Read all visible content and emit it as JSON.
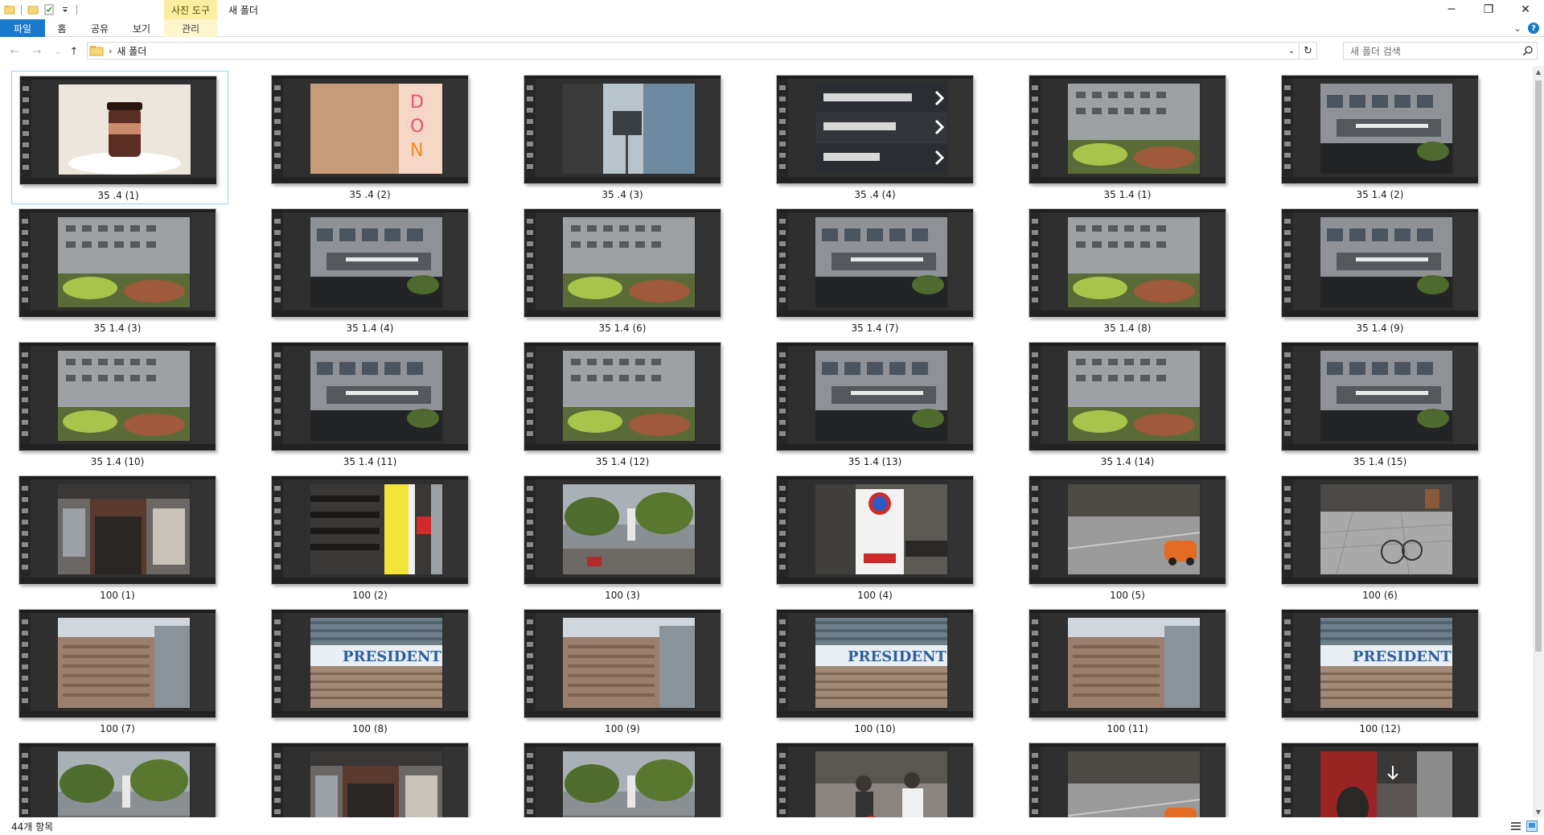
{
  "titlebar": {
    "context_tab_label": "사진 도구",
    "window_title": "새 폴더",
    "minimize": "─",
    "maximize": "❐",
    "close": "✕"
  },
  "ribbon": {
    "tabs": [
      "파일",
      "홈",
      "공유",
      "보기",
      "관리"
    ],
    "expand": "⌄",
    "help": "?"
  },
  "nav": {
    "back": "←",
    "forward": "→",
    "recent": "⌄",
    "up": "↑",
    "breadcrumb_sep": "›",
    "breadcrumb": "새 폴더",
    "dropdown": "⌄",
    "refresh": "↻"
  },
  "search": {
    "placeholder": "새 폴더 검색"
  },
  "files": [
    {
      "name": "35 .4 (1)",
      "photo": "cup",
      "selected": true
    },
    {
      "name": "35 .4 (2)",
      "photo": "donut"
    },
    {
      "name": "35 .4 (3)",
      "photo": "street-sign"
    },
    {
      "name": "35 .4 (4)",
      "photo": "direction-sign"
    },
    {
      "name": "35 1.4 (1)",
      "photo": "building-garden"
    },
    {
      "name": "35 1.4 (2)",
      "photo": "building-sign"
    },
    {
      "name": "35 1.4 (3)",
      "photo": "building-garden"
    },
    {
      "name": "35 1.4 (4)",
      "photo": "building-sign"
    },
    {
      "name": "35 1.4 (6)",
      "photo": "building-garden"
    },
    {
      "name": "35 1.4 (7)",
      "photo": "building-sign"
    },
    {
      "name": "35 1.4 (8)",
      "photo": "building-garden"
    },
    {
      "name": "35 1.4 (9)",
      "photo": "building-sign"
    },
    {
      "name": "35 1.4 (10)",
      "photo": "building-garden"
    },
    {
      "name": "35 1.4 (11)",
      "photo": "building-sign"
    },
    {
      "name": "35 1.4 (12)",
      "photo": "building-garden"
    },
    {
      "name": "35 1.4 (13)",
      "photo": "building-sign"
    },
    {
      "name": "35 1.4 (14)",
      "photo": "building-garden"
    },
    {
      "name": "35 1.4 (15)",
      "photo": "building-sign"
    },
    {
      "name": "100 (1)",
      "photo": "storefront"
    },
    {
      "name": "100 (2)",
      "photo": "kimchi-sign"
    },
    {
      "name": "100 (3)",
      "photo": "street-trees"
    },
    {
      "name": "100 (4)",
      "photo": "no-parking"
    },
    {
      "name": "100 (5)",
      "photo": "road-car"
    },
    {
      "name": "100 (6)",
      "photo": "bicycle"
    },
    {
      "name": "100 (7)",
      "photo": "brick-building"
    },
    {
      "name": "100 (8)",
      "photo": "president-hotel"
    },
    {
      "name": "100 (9)",
      "photo": "brick-building"
    },
    {
      "name": "100 (10)",
      "photo": "president-hotel"
    },
    {
      "name": "100 (11)",
      "photo": "brick-building"
    },
    {
      "name": "100 (12)",
      "photo": "president-hotel"
    },
    {
      "name": "",
      "photo": "street-trees"
    },
    {
      "name": "",
      "photo": "storefront"
    },
    {
      "name": "",
      "photo": "street-trees"
    },
    {
      "name": "",
      "photo": "crowd"
    },
    {
      "name": "",
      "photo": "road-car"
    },
    {
      "name": "",
      "photo": "crowd-red"
    }
  ],
  "status": {
    "item_count": "44개 항목"
  },
  "colors": {
    "accent": "#1979ca",
    "selection": "#99d1ff",
    "context_tab": "#fbeea1"
  }
}
